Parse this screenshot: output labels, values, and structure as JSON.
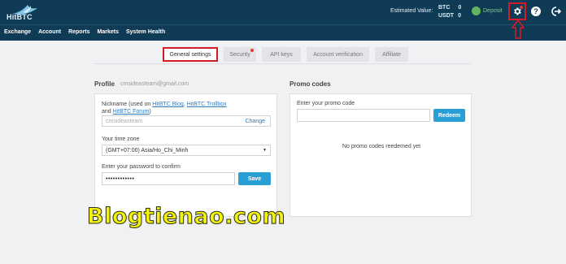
{
  "brand": {
    "logo_text": "HitBTC"
  },
  "header": {
    "estimated_label": "Estimated Value:",
    "balances": [
      {
        "currency": "BTC",
        "amount": "0"
      },
      {
        "currency": "USDT",
        "amount": "0"
      }
    ],
    "deposit_label": "Deposit",
    "help_label": "?"
  },
  "nav": {
    "items": [
      "Exchange",
      "Account",
      "Reports",
      "Markets",
      "System Health"
    ]
  },
  "tabs": [
    {
      "label": "General settings",
      "active": true
    },
    {
      "label": "Security",
      "badge": true
    },
    {
      "label": "API keys"
    },
    {
      "label": "Account verification"
    },
    {
      "label": "Affiliate"
    }
  ],
  "profile": {
    "title": "Profile",
    "email": "cmsideasteam@gmail.com",
    "nickname_text": "Nickname (used on",
    "link_blog": "HitBTC Blog",
    "link_trollbox": "HitBTC Trollbox",
    "and_text": "and",
    "link_forum": "HitBTC Forum",
    "nickname_value": "cmsideasteam",
    "change_label": "Change",
    "timezone_label": "Your time zone",
    "timezone_value": "(GMT+07:00) Asia/Ho_Chi_Minh",
    "password_label": "Enter your password to confirm",
    "password_value": "••••••••••••",
    "save_label": "Save"
  },
  "promo": {
    "title": "Promo codes",
    "input_label": "Enter your promo code",
    "redeem_label": "Redeem",
    "empty_text": "No promo codes reedemed yet"
  },
  "watermark": "Blogtienao.com",
  "colors": {
    "header_bg": "#0f3b57",
    "accent": "#2a9fd6",
    "highlight": "#d51c24"
  }
}
